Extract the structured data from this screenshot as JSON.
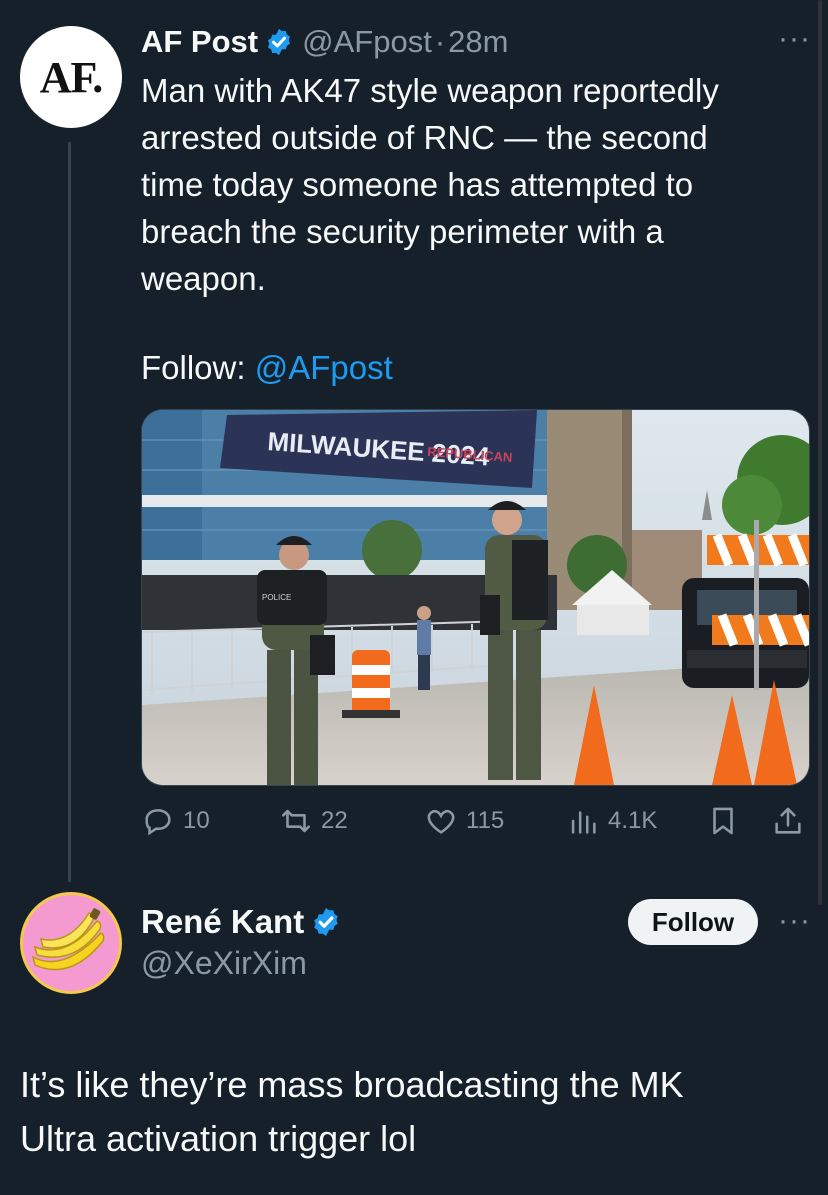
{
  "tweet": {
    "avatar_text": "AF.",
    "author_name": "AF Post",
    "handle": "@AFpost",
    "separator": "·",
    "time": "28m",
    "more": "···",
    "text": "Man with AK47 style weapon reportedly\narrested outside of RNC — the second\ntime today someone has attempted to\nbreach the security perimeter with a\nweapon.",
    "follow_prefix": "Follow: ",
    "follow_handle": "@AFpost",
    "image_banner_text": "MILWAUKEE 2024",
    "image_banner_sub": "REPUBLICAN",
    "image_vest_text": "POLICE",
    "metrics": {
      "replies": "10",
      "retweets": "22",
      "likes": "115",
      "views": "4.1K"
    }
  },
  "reply": {
    "author_name": "René Kant",
    "handle": "@XeXirXim",
    "follow_label": "Follow",
    "more": "···",
    "text": "It’s like they’re mass broadcasting the MK\nUltra activation trigger lol"
  },
  "colors": {
    "background": "#15202b",
    "text": "#f7f9f9",
    "secondary": "#8b98a5",
    "link": "#1d9bf0",
    "verified": "#1d9bf0",
    "avatar_bg_reply": "#f49ad0"
  },
  "icons": {
    "verified": "verified-badge-icon",
    "reply": "reply-icon",
    "retweet": "retweet-icon",
    "like": "heart-icon",
    "views": "views-chart-icon",
    "bookmark": "bookmark-icon",
    "share": "share-icon",
    "avatar_reply": "banana-icon"
  }
}
